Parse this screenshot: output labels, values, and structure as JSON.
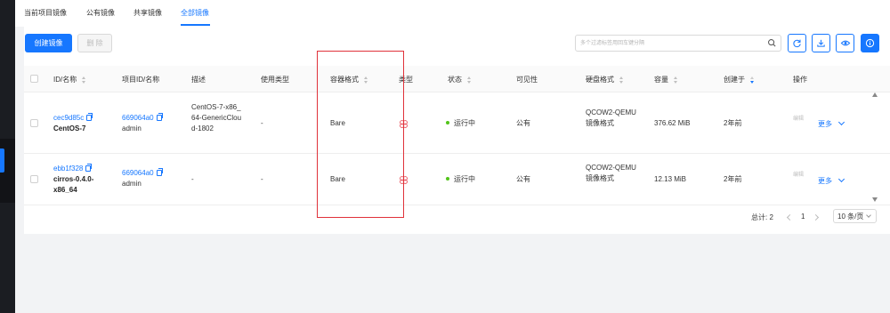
{
  "tabs": [
    {
      "label": "当前项目镜像",
      "active": false
    },
    {
      "label": "公有镜像",
      "active": false
    },
    {
      "label": "共享镜像",
      "active": false
    },
    {
      "label": "全部镜像",
      "active": true
    }
  ],
  "toolbar": {
    "create_label": "创建镜像",
    "delete_label": "删 除",
    "search_placeholder": "多个过滤标签用回车键分隔",
    "icons": [
      "search-icon",
      "refresh-icon",
      "download-icon",
      "eye-icon",
      "info-icon"
    ]
  },
  "table": {
    "columns": [
      {
        "label": "ID/名称",
        "sortable": true
      },
      {
        "label": "项目ID/名称",
        "sortable": false
      },
      {
        "label": "描述",
        "sortable": false
      },
      {
        "label": "使用类型",
        "sortable": false
      },
      {
        "label": "容器格式",
        "sortable": true
      },
      {
        "label": "类型",
        "sortable": false
      },
      {
        "label": "状态",
        "sortable": true
      },
      {
        "label": "可见性",
        "sortable": false
      },
      {
        "label": "硬盘格式",
        "sortable": true
      },
      {
        "label": "容量",
        "sortable": true
      },
      {
        "label": "创建于",
        "sortable": true,
        "sort": "desc"
      },
      {
        "label": "操作",
        "sortable": false
      }
    ],
    "rows": [
      {
        "id": "cec9d85c",
        "name": "CentOS-7",
        "project_id": "669064a0",
        "project_name": "admin",
        "description": "CentOS-7-x86_64-GenericCloud-1802",
        "usage_type": "-",
        "container_format": "Bare",
        "type_icon": "os-type-icon",
        "status": "运行中",
        "visibility": "公有",
        "disk_format": "QCOW2-QEMU 镜像格式",
        "size": "376.62 MiB",
        "created": "2年前",
        "action_primary": "编辑",
        "action_more": "更多"
      },
      {
        "id": "ebb1f328",
        "name": "cirros-0.4.0-x86_64",
        "project_id": "669064a0",
        "project_name": "admin",
        "description": "-",
        "usage_type": "-",
        "container_format": "Bare",
        "type_icon": "os-type-icon",
        "status": "运行中",
        "visibility": "公有",
        "disk_format": "QCOW2-QEMU 镜像格式",
        "size": "12.13 MiB",
        "created": "2年前",
        "action_primary": "编辑",
        "action_more": "更多"
      }
    ]
  },
  "pagination": {
    "total_label": "总计: 2",
    "current_page": "1",
    "page_size": "10 条/页"
  },
  "colors": {
    "primary": "#1677ff",
    "status_ok": "#52c41a",
    "highlight_border": "#e0323a",
    "type_icon": "#e8505b"
  }
}
